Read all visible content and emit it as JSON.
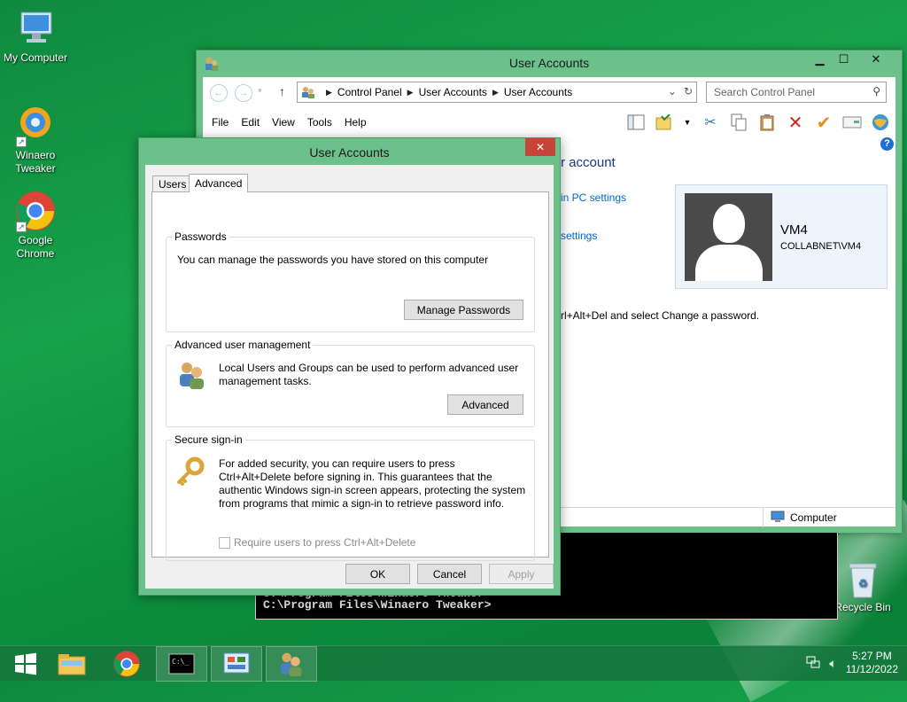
{
  "desktop": {
    "icons": [
      {
        "label": "My Computer"
      },
      {
        "label": "Winaero Tweaker"
      },
      {
        "label": "Google Chrome"
      }
    ],
    "recycle_bin_label": "Recycle Bin"
  },
  "control_panel": {
    "title": "User Accounts",
    "breadcrumb": [
      "Control Panel",
      "User Accounts",
      "User Accounts"
    ],
    "search_placeholder": "Search Control Panel",
    "menu": [
      "File",
      "Edit",
      "View",
      "Tools",
      "Help"
    ],
    "heading_fragment": "r account",
    "link1_fragment": "in PC settings",
    "link2_fragment": "settings",
    "note_fragment": "rl+Alt+Del and select Change a password.",
    "user": {
      "name": "VM4",
      "domain": "COLLABNET\\VM4"
    },
    "status_zone": "Computer"
  },
  "console": {
    "lines": [
      "C:\\Program Files\\Winaero Tweaker>",
      "C:\\Program Files\\Winaero Tweaker>"
    ]
  },
  "dialog": {
    "title": "User Accounts",
    "tabs": [
      "Users",
      "Advanced"
    ],
    "active_tab": "Advanced",
    "passwords": {
      "title": "Passwords",
      "text": "You can manage the passwords you have stored on this computer",
      "button": "Manage Passwords"
    },
    "advanced_mgmt": {
      "title": "Advanced user management",
      "text": "Local Users and Groups can be used to perform advanced user management tasks.",
      "button": "Advanced"
    },
    "secure_signin": {
      "title": "Secure sign-in",
      "text": "For added security, you can require users to press Ctrl+Alt+Delete before signing in. This guarantees that the authentic Windows sign-in screen appears, protecting the system from programs that mimic a sign-in to retrieve password info.",
      "checkbox_label": "Require users to press Ctrl+Alt+Delete",
      "checked": false
    },
    "buttons": {
      "ok": "OK",
      "cancel": "Cancel",
      "apply": "Apply"
    }
  },
  "taskbar": {
    "time": "5:27 PM",
    "date": "11/12/2022"
  },
  "colors": {
    "window_frame": "#6cc08a",
    "link": "#0066cc",
    "desktop": "#16a24a",
    "close_red": "#c7443a"
  }
}
